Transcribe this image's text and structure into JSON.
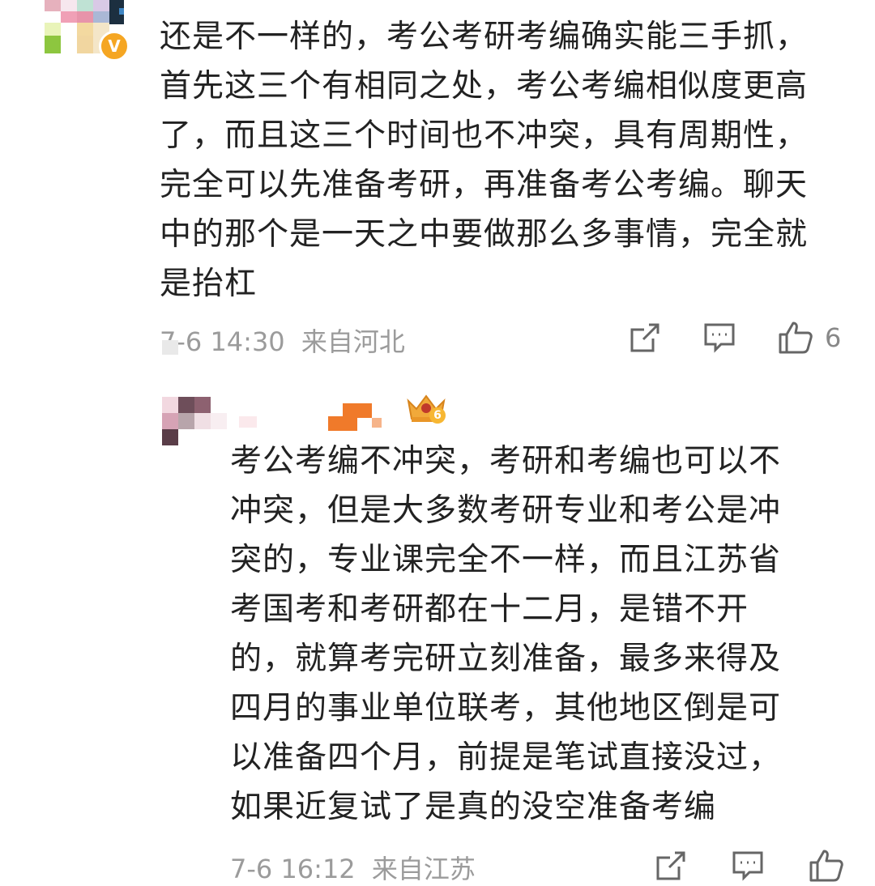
{
  "comments": [
    {
      "lines": [
        "还是不一样的，考公考研考编确实能三手抓，",
        "首先这三个有相同之处，考公考编相似度更高",
        "了，而且这三个时间也不冲突，具有周期性，",
        "完全可以先准备考研，再准备考公考编。聊天",
        "中的那个是一天之中要做那么多事情，完全就",
        "是抬杠"
      ],
      "time": "7-6 14:30",
      "location": "来自河北",
      "likes": "6",
      "verified_badge": "V"
    },
    {
      "lines": [
        "考公考编不冲突，考研和考编也可以不",
        "冲突，但是大多数考研专业和考公是冲",
        "突的，专业课完全不一样，而且江苏省",
        "考国考和考研都在十二月，是错不开",
        "的，就算考完研立刻准备，最多来得及",
        "四月的事业单位联考，其他地区倒是可",
        "以准备四个月，前提是笔试直接没过，",
        "如果近复试了是真的没空准备考编"
      ],
      "time": "7-6 16:12",
      "location": "来自江苏",
      "level_badge": "6"
    }
  ],
  "icons": {
    "share": "share-icon",
    "comment": "comment-icon",
    "like": "thumbs-up-icon",
    "crown": "crown-icon"
  },
  "colors": {
    "text": "#222222",
    "meta": "#9b9b9b",
    "icon": "#666666",
    "verified": "#f5a623",
    "username_blur": "#f07a2a"
  }
}
